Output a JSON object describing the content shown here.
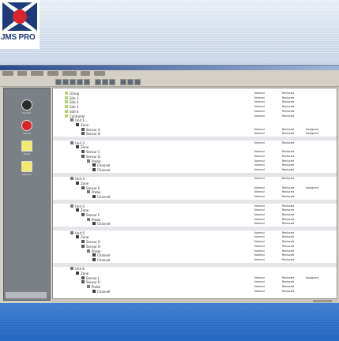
{
  "brand": {
    "logo_text": "JMS PRO",
    "colors": {
      "red": "#d6262b",
      "navy": "#1d3b7a",
      "footer": "#2a6cc8"
    }
  },
  "window": {
    "menu_count": 7,
    "toolbar_icons": [
      "new-icon",
      "open-icon",
      "save-icon",
      "cut-icon",
      "copy-icon",
      "paste-icon",
      "print-icon",
      "filter-icon",
      "refresh-icon",
      "find-icon",
      "help-icon"
    ]
  },
  "left_panel": {
    "items": [
      {
        "icon": "monitor-icon",
        "label": "Monitor"
      },
      {
        "icon": "alarm-icon",
        "label": "Alarms"
      },
      {
        "icon": "note-icon",
        "label": "Notes"
      },
      {
        "icon": "report-icon",
        "label": "Reports"
      }
    ]
  },
  "tree": {
    "rows": [
      {
        "label": "Group",
        "c1": "Normal",
        "c2": "Reduced",
        "c3": ""
      },
      {
        "label": "Site 1",
        "c1": "Normal",
        "c2": "Reduced",
        "c3": ""
      },
      {
        "label": "Site 2",
        "c1": "Normal",
        "c2": "Reduced",
        "c3": ""
      },
      {
        "label": "Site 3",
        "c1": "Normal",
        "c2": "Reduced",
        "c3": ""
      },
      {
        "label": "Site 4",
        "c1": "Normal",
        "c2": "Reduced",
        "c3": ""
      },
      {
        "label": "Controller",
        "c1": "Normal",
        "c2": "Reduced",
        "c3": ""
      },
      {
        "label": "Unit 1",
        "c1": "",
        "c2": "",
        "c3": ""
      },
      {
        "label": "Zone",
        "c1": "",
        "c2": "",
        "c3": ""
      },
      {
        "label": "Sensor A",
        "c1": "Normal",
        "c2": "Reduced",
        "c3": "Assigned"
      },
      {
        "label": "Sensor B",
        "c1": "Normal",
        "c2": "Reduced",
        "c3": "Assigned"
      },
      {
        "label": "",
        "c1": "",
        "c2": "",
        "c3": ""
      },
      {
        "label": "Unit 2",
        "c1": "Normal",
        "c2": "Reduced",
        "c3": ""
      },
      {
        "label": "Zone",
        "c1": "",
        "c2": "",
        "c3": ""
      },
      {
        "label": "Sensor C",
        "c1": "Normal",
        "c2": "Reduced",
        "c3": ""
      },
      {
        "label": "Sensor D",
        "c1": "Normal",
        "c2": "Reduced",
        "c3": ""
      },
      {
        "label": "Probe",
        "c1": "Normal",
        "c2": "Reduced",
        "c3": ""
      },
      {
        "label": "Channel",
        "c1": "Normal",
        "c2": "Reduced",
        "c3": ""
      },
      {
        "label": "Channel",
        "c1": "Normal",
        "c2": "Reduced",
        "c3": ""
      },
      {
        "label": "",
        "c1": "",
        "c2": "",
        "c3": ""
      },
      {
        "label": "Unit 3",
        "c1": "Normal",
        "c2": "Reduced",
        "c3": ""
      },
      {
        "label": "Zone",
        "c1": "",
        "c2": "",
        "c3": ""
      },
      {
        "label": "Sensor E",
        "c1": "Normal",
        "c2": "Reduced",
        "c3": "Assigned"
      },
      {
        "label": "Probe",
        "c1": "Normal",
        "c2": "Reduced",
        "c3": ""
      },
      {
        "label": "Channel",
        "c1": "Normal",
        "c2": "Reduced",
        "c3": ""
      },
      {
        "label": "",
        "c1": "",
        "c2": "",
        "c3": ""
      },
      {
        "label": "Unit 4",
        "c1": "Normal",
        "c2": "Reduced",
        "c3": ""
      },
      {
        "label": "Zone",
        "c1": "Normal",
        "c2": "Reduced",
        "c3": ""
      },
      {
        "label": "Sensor F",
        "c1": "Normal",
        "c2": "Reduced",
        "c3": ""
      },
      {
        "label": "Probe",
        "c1": "Normal",
        "c2": "Reduced",
        "c3": ""
      },
      {
        "label": "Channel",
        "c1": "Normal",
        "c2": "Reduced",
        "c3": ""
      },
      {
        "label": "",
        "c1": "",
        "c2": "",
        "c3": ""
      },
      {
        "label": "Unit 5",
        "c1": "Normal",
        "c2": "Reduced",
        "c3": ""
      },
      {
        "label": "Zone",
        "c1": "Normal",
        "c2": "Reduced",
        "c3": ""
      },
      {
        "label": "Sensor G",
        "c1": "Normal",
        "c2": "Reduced",
        "c3": ""
      },
      {
        "label": "Sensor H",
        "c1": "Normal",
        "c2": "Reduced",
        "c3": ""
      },
      {
        "label": "Probe",
        "c1": "Normal",
        "c2": "Reduced",
        "c3": ""
      },
      {
        "label": "Channel",
        "c1": "Normal",
        "c2": "Reduced",
        "c3": ""
      },
      {
        "label": "Channel",
        "c1": "Normal",
        "c2": "Reduced",
        "c3": ""
      },
      {
        "label": "",
        "c1": "",
        "c2": "",
        "c3": ""
      },
      {
        "label": "Unit 6",
        "c1": "",
        "c2": "",
        "c3": ""
      },
      {
        "label": "Zone",
        "c1": "",
        "c2": "",
        "c3": ""
      },
      {
        "label": "Sensor J",
        "c1": "Normal",
        "c2": "Reduced",
        "c3": "Assigned"
      },
      {
        "label": "Sensor K",
        "c1": "Normal",
        "c2": "Reduced",
        "c3": ""
      },
      {
        "label": "Probe",
        "c1": "Normal",
        "c2": "Reduced",
        "c3": ""
      },
      {
        "label": "Channel",
        "c1": "Normal",
        "c2": "Reduced",
        "c3": ""
      }
    ]
  }
}
